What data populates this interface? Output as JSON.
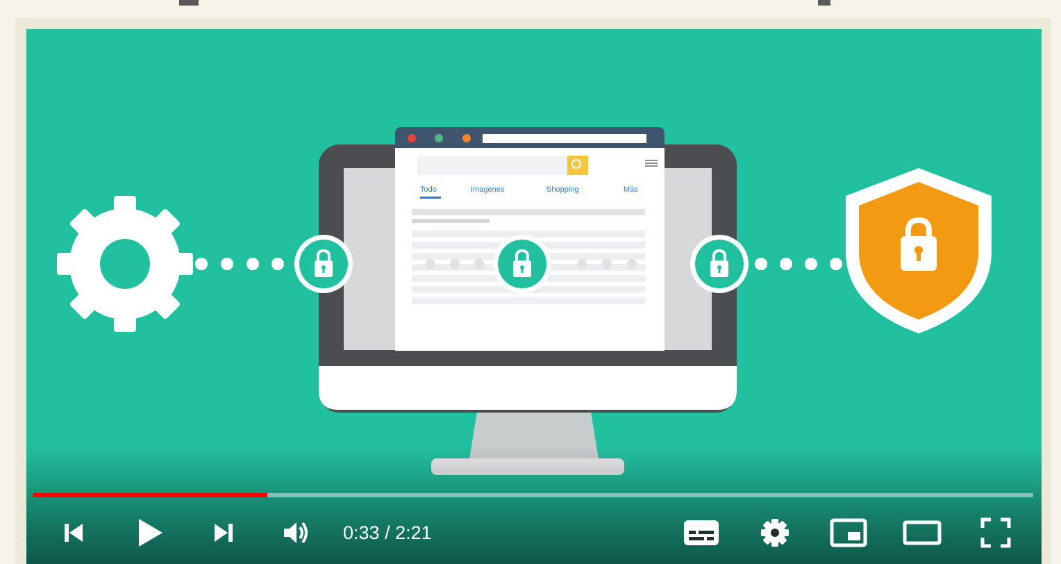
{
  "player": {
    "current_time": "0:33",
    "separator": " / ",
    "duration": "2:21",
    "progress_fraction": 0.234,
    "colors": {
      "background": "#21c09f",
      "progress_played": "#ff0000",
      "shield": "#f39a12",
      "lock_badge": "#21c09f"
    }
  },
  "browser": {
    "tabs": [
      "Todo",
      "Imagenes",
      "Shopping",
      "Más"
    ]
  },
  "controls": {
    "icons": [
      "previous-icon",
      "play-icon",
      "next-icon",
      "volume-icon",
      "subtitles-icon",
      "settings-icon",
      "miniplayer-icon",
      "theater-icon",
      "fullscreen-icon"
    ]
  }
}
